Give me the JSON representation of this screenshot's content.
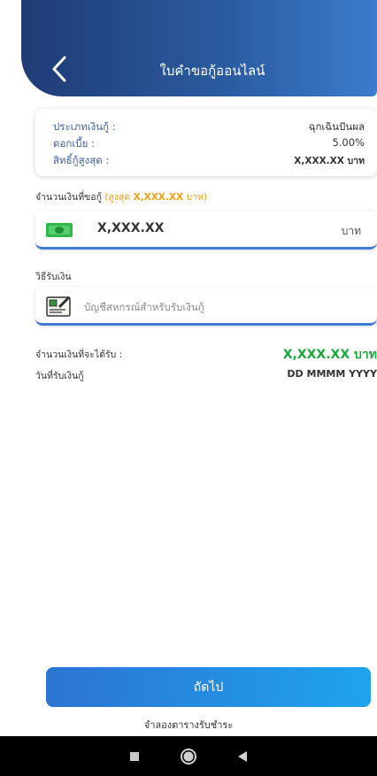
{
  "header": {
    "title": "ใบคำขอกู้ออนไลน์"
  },
  "info": {
    "loan_type_label": "ประเภทเงินกู้ :",
    "loan_type_value": "ฉุกเฉินปันผล",
    "interest_label": "ดอกเบี้ย :",
    "interest_value": "5.00%",
    "max_right_label": "สิทธิ์กู้สูงสุด :",
    "max_right_value": "X,XXX.XX บาท"
  },
  "amount_section": {
    "label": "จำนวนเงินที่ขอกู้",
    "max_prefix": "(สูงสุด",
    "max_value": "X,XXX.XX",
    "max_suffix": "บาท)",
    "value": "X,XXX.XX",
    "unit": "บาท"
  },
  "method_section": {
    "label": "วิธีรับเงิน",
    "value": "บัญชีสหกรณ์สำหรับรับเงินกู้"
  },
  "summary": {
    "receive_label": "จำนวนเงินที่จะได้รับ :",
    "receive_value": "X,XXX.XX บาท",
    "date_label": "วันที่รับเงินกู้",
    "date_value": "DD MMMM YYYY"
  },
  "actions": {
    "next_label": "ถัดไป",
    "schedule_label": "จำลองตารางรับชำระ"
  }
}
